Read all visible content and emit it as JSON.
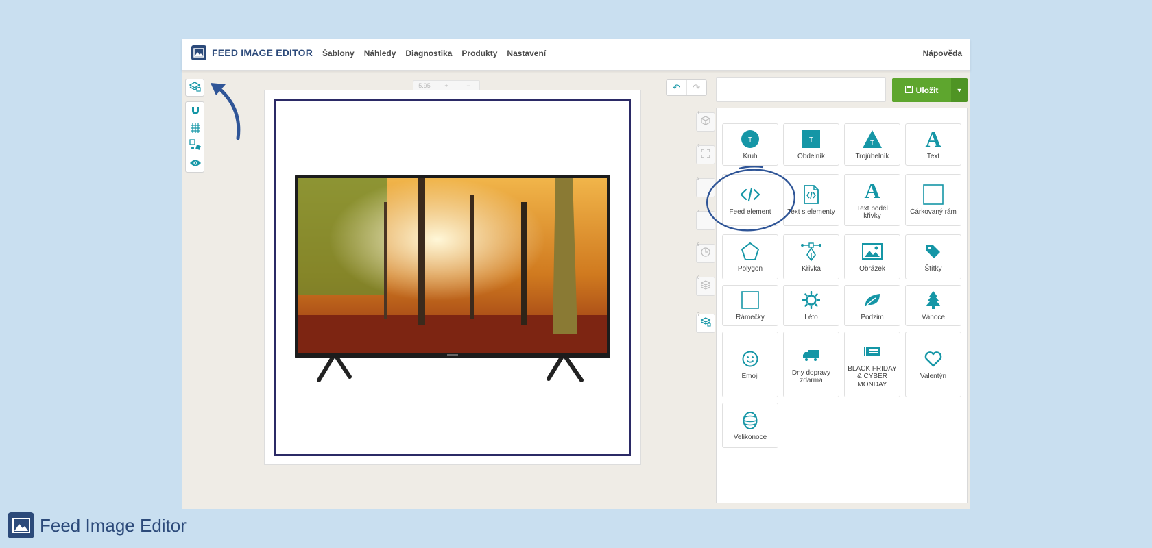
{
  "app": {
    "title": "FEED IMAGE EDITOR",
    "nav": [
      "Šablony",
      "Náhledy",
      "Diagnostika",
      "Produkty",
      "Nastavení"
    ],
    "help": "Nápověda"
  },
  "toolbar": {
    "zoom_text": "5.95",
    "zoom_plus": "+",
    "zoom_minus": "−",
    "undo": "↶",
    "redo": "↷"
  },
  "side_tabs": [
    "1",
    "2",
    "3",
    "4",
    "5",
    "6",
    "7"
  ],
  "save": {
    "label": "Uložit"
  },
  "name_input": {
    "value": ""
  },
  "elements": [
    {
      "label": "Kruh",
      "icon": "circle-icon"
    },
    {
      "label": "Obdelník",
      "icon": "rectangle-icon"
    },
    {
      "label": "Trojúhelník",
      "icon": "triangle-icon"
    },
    {
      "label": "Text",
      "icon": "text-icon"
    },
    {
      "label": "Feed element",
      "icon": "code-icon"
    },
    {
      "label": "Text s elementy",
      "icon": "code-file-icon"
    },
    {
      "label": "Text podél křivky",
      "icon": "text-curve-icon"
    },
    {
      "label": "Čárkovaný rám",
      "icon": "dashed-frame-icon"
    },
    {
      "label": "Polygon",
      "icon": "polygon-icon"
    },
    {
      "label": "Křivka",
      "icon": "pen-curve-icon"
    },
    {
      "label": "Obrázek",
      "icon": "image-icon"
    },
    {
      "label": "Štítky",
      "icon": "tag-icon"
    },
    {
      "label": "Rámečky",
      "icon": "frame-icon"
    },
    {
      "label": "Léto",
      "icon": "sun-icon"
    },
    {
      "label": "Podzim",
      "icon": "leaf-icon"
    },
    {
      "label": "Vánoce",
      "icon": "tree-icon"
    },
    {
      "label": "Emoji",
      "icon": "smile-icon"
    },
    {
      "label": "Dny dopravy zdarma",
      "icon": "truck-icon"
    },
    {
      "label": "BLACK FRIDAY & CYBER MONDAY",
      "icon": "black-friday-icon"
    },
    {
      "label": "Valentýn",
      "icon": "heart-icon"
    },
    {
      "label": "Velikonoce",
      "icon": "easter-egg-icon"
    }
  ],
  "footer": {
    "text": "Feed Image Editor"
  },
  "colors": {
    "accent": "#1596a6",
    "brand": "#2c4a7a",
    "save": "#5ea62e",
    "canvas_border": "#2b2a66"
  }
}
